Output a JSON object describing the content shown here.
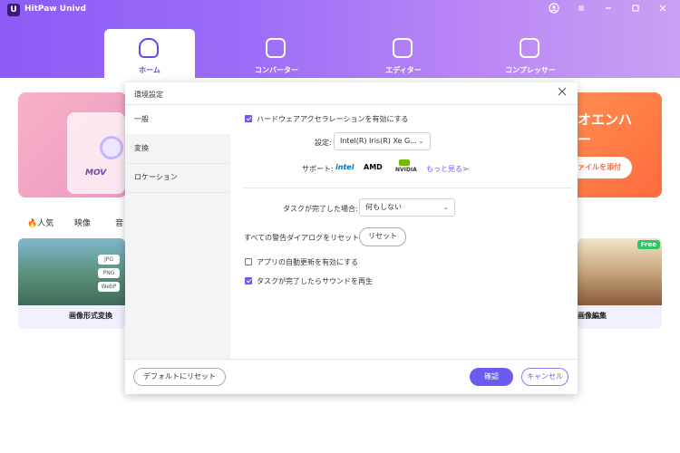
{
  "app": {
    "title": "HitPaw Univd",
    "logo_glyph": "U"
  },
  "window_controls": {
    "account_icon": "account-icon",
    "menu_icon": "menu-icon",
    "minimize_icon": "minimize-icon",
    "maximize_icon": "maximize-icon",
    "close_icon": "close-icon"
  },
  "nav": {
    "tabs": [
      {
        "label": "ホーム",
        "icon": "home-icon",
        "active": true
      },
      {
        "label": "コンバーター",
        "icon": "converter-icon",
        "active": false
      },
      {
        "label": "エディター",
        "icon": "editor-icon",
        "active": false
      },
      {
        "label": "コンプレッサー",
        "icon": "compressor-icon",
        "active": false
      }
    ]
  },
  "home": {
    "banner_left_badge": "MOV",
    "banner_right_text_line1": "オエンハ",
    "banner_right_text_line2": "ー",
    "banner_right_button": "ァイルを添付",
    "categories": [
      "人気",
      "映像",
      "音"
    ],
    "cards": [
      {
        "caption": "画像形式変換",
        "formats": [
          "JPG",
          "PNG",
          "WebP"
        ]
      },
      {
        "caption": "画像編集",
        "badge": "Free"
      }
    ]
  },
  "dialog": {
    "title": "環境設定",
    "sidebar": [
      "一般",
      "変換",
      "ロケーション"
    ],
    "hw_accel": {
      "label": "ハードウェアアクセラレーションを有効にする",
      "checked": true
    },
    "setting": {
      "label": "設定:",
      "value": "Intel(R) Iris(R) Xe G..."
    },
    "support": {
      "label": "サポート:",
      "brands": [
        "intel",
        "AMD",
        "NVIDIA"
      ],
      "more_link": "もっと見る>"
    },
    "on_complete": {
      "label": "タスクが完了した場合:",
      "value": "何もしない"
    },
    "reset_warnings": {
      "label": "すべての警告ダイアログをリセット:",
      "button": "リセット"
    },
    "auto_update": {
      "label": "アプリの自動更新を有効にする",
      "checked": false
    },
    "play_sound": {
      "label": "タスクが完了したらサウンドを再生",
      "checked": true
    },
    "footer": {
      "reset_default": "デフォルトにリセット",
      "confirm": "確認",
      "cancel": "キャンセル"
    }
  },
  "colors": {
    "accent": "#6b5cf0",
    "header_start": "#8b5cf6",
    "header_end": "#c9a0f2",
    "intel": "#0071c5",
    "amd": "#000000",
    "nvidia": "#76b900"
  }
}
